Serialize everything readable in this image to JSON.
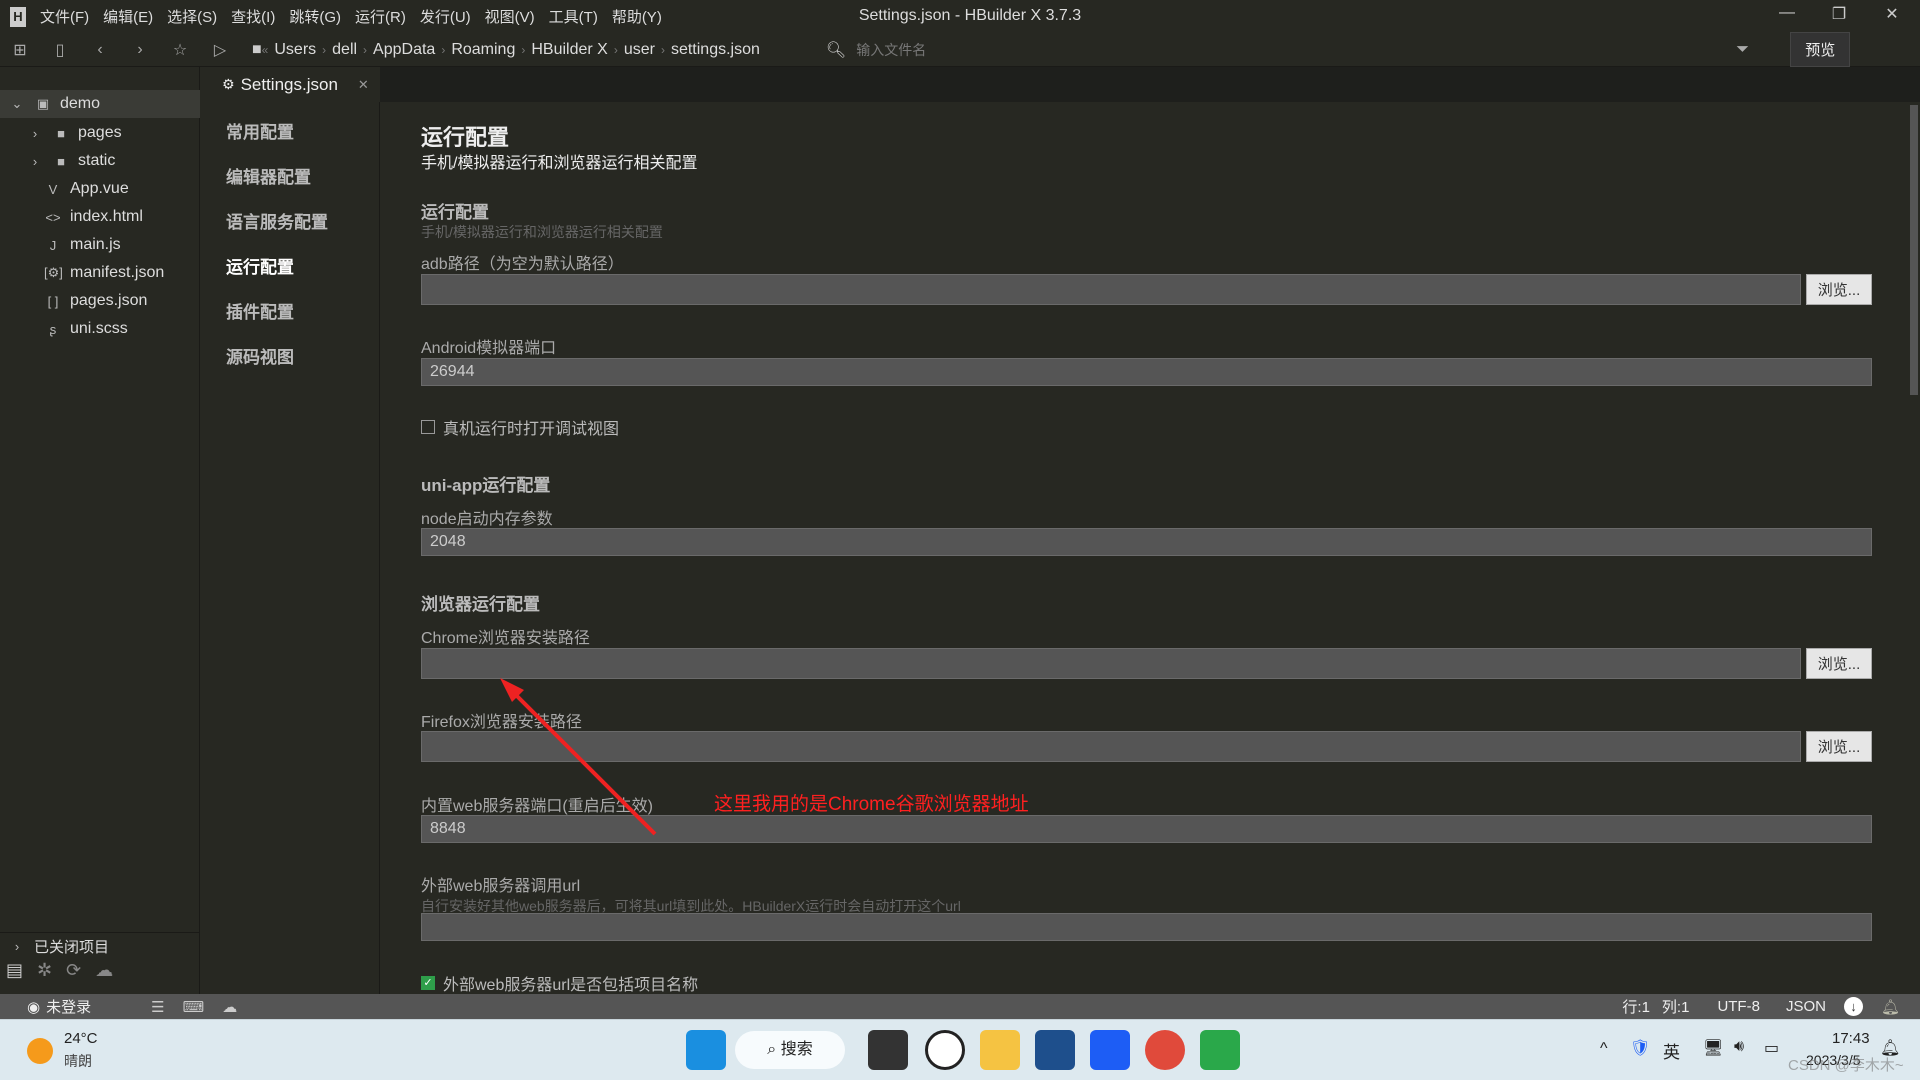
{
  "window": {
    "title": "Settings.json - HBuilder X 3.7.3",
    "menu": [
      "文件(F)",
      "编辑(E)",
      "选择(S)",
      "查找(I)",
      "跳转(G)",
      "运行(R)",
      "发行(U)",
      "视图(V)",
      "工具(T)",
      "帮助(Y)"
    ]
  },
  "toolbar": {
    "breadcrumb": [
      "Users",
      "dell",
      "AppData",
      "Roaming",
      "HBuilder X",
      "user",
      "settings.json"
    ],
    "search_placeholder": "输入文件名",
    "preview": "预览"
  },
  "sidebar": {
    "project": "demo",
    "items": [
      {
        "name": "pages",
        "icon": "folder-icon"
      },
      {
        "name": "static",
        "icon": "folder-icon"
      },
      {
        "name": "App.vue",
        "icon": "vue-file-icon"
      },
      {
        "name": "index.html",
        "icon": "html-file-icon"
      },
      {
        "name": "main.js",
        "icon": "js-file-icon"
      },
      {
        "name": "manifest.json",
        "icon": "manifest-icon"
      },
      {
        "name": "pages.json",
        "icon": "json-file-icon"
      },
      {
        "name": "uni.scss",
        "icon": "scss-file-icon"
      }
    ],
    "closed_projects": "已关闭项目"
  },
  "tab": {
    "label": "Settings.json"
  },
  "nav": [
    "常用配置",
    "编辑器配置",
    "语言服务配置",
    "运行配置",
    "插件配置",
    "源码视图"
  ],
  "main": {
    "title": "运行配置",
    "subtitle": "手机/模拟器运行和浏览器运行相关配置",
    "section1": {
      "title": "运行配置",
      "desc": "手机/模拟器运行和浏览器运行相关配置"
    },
    "adb": {
      "label": "adb路径（为空为默认路径）",
      "value": ""
    },
    "android_port": {
      "label": "Android模拟器端口",
      "value": "26944"
    },
    "debug_view": {
      "label": "真机运行时打开调试视图",
      "checked": false
    },
    "uniapp": {
      "title": "uni-app运行配置"
    },
    "node_mem": {
      "label": "node启动内存参数",
      "value": "2048"
    },
    "browser": {
      "title": "浏览器运行配置"
    },
    "chrome": {
      "label": "Chrome浏览器安装路径",
      "value": ""
    },
    "firefox": {
      "label": "Firefox浏览器安装路径",
      "value": ""
    },
    "web_port": {
      "label": "内置web服务器端口(重启后生效)",
      "value": "8848"
    },
    "ext_url": {
      "label": "外部web服务器调用url",
      "desc": "自行安装好其他web服务器后，可将其url填到此处。HBuilderX运行时会自动打开这个url",
      "value": ""
    },
    "ext_include": {
      "label": "外部web服务器url是否包括项目名称",
      "checked": true
    },
    "browse": "浏览...",
    "annotation": "这里我用的是Chrome谷歌浏览器地址"
  },
  "status": {
    "login": "未登录",
    "line": "行:1",
    "col": "列:1",
    "encoding": "UTF-8",
    "lang": "JSON"
  },
  "taskbar": {
    "temp": "24°C",
    "weather": "晴朗",
    "search": "搜索",
    "ime": "英",
    "time": "17:43",
    "date": "2023/3/5",
    "watermark": "CSDN @李木木~"
  },
  "colors": {
    "bg": "#272822",
    "input": "#555555",
    "annotation": "#ff2020",
    "accent_check": "#2e9e4a"
  }
}
